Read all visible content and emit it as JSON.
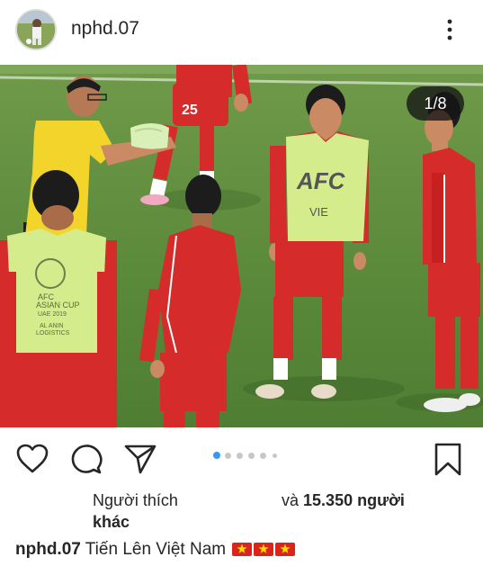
{
  "post": {
    "username": "nphd.07",
    "image_counter": "1/8",
    "vest_text": "AFC",
    "vest_country": "VIE",
    "vest_cup_line1": "AFC",
    "vest_cup_line2": "ASIAN CUP",
    "vest_cup_line3": "UAE 2019",
    "vest_cup_line4": "AL ANIN",
    "vest_cup_line5": "LOGISTICS",
    "jersey_number": "25"
  },
  "likes": {
    "prefix": "Người thích",
    "and": "và",
    "count": "15.350 người",
    "suffix": "khác"
  },
  "caption": {
    "username": "nphd.07",
    "text": "Tiến Lên Việt Nam"
  },
  "carousel": {
    "total_dots": 6,
    "active_index": 0
  },
  "colors": {
    "accent": "#3897f0",
    "text": "#262626",
    "flag_red": "#da251d",
    "flag_star": "#ffde00"
  },
  "icons": [
    "more-vert-icon",
    "heart-icon",
    "comment-icon",
    "send-icon",
    "bookmark-icon"
  ]
}
